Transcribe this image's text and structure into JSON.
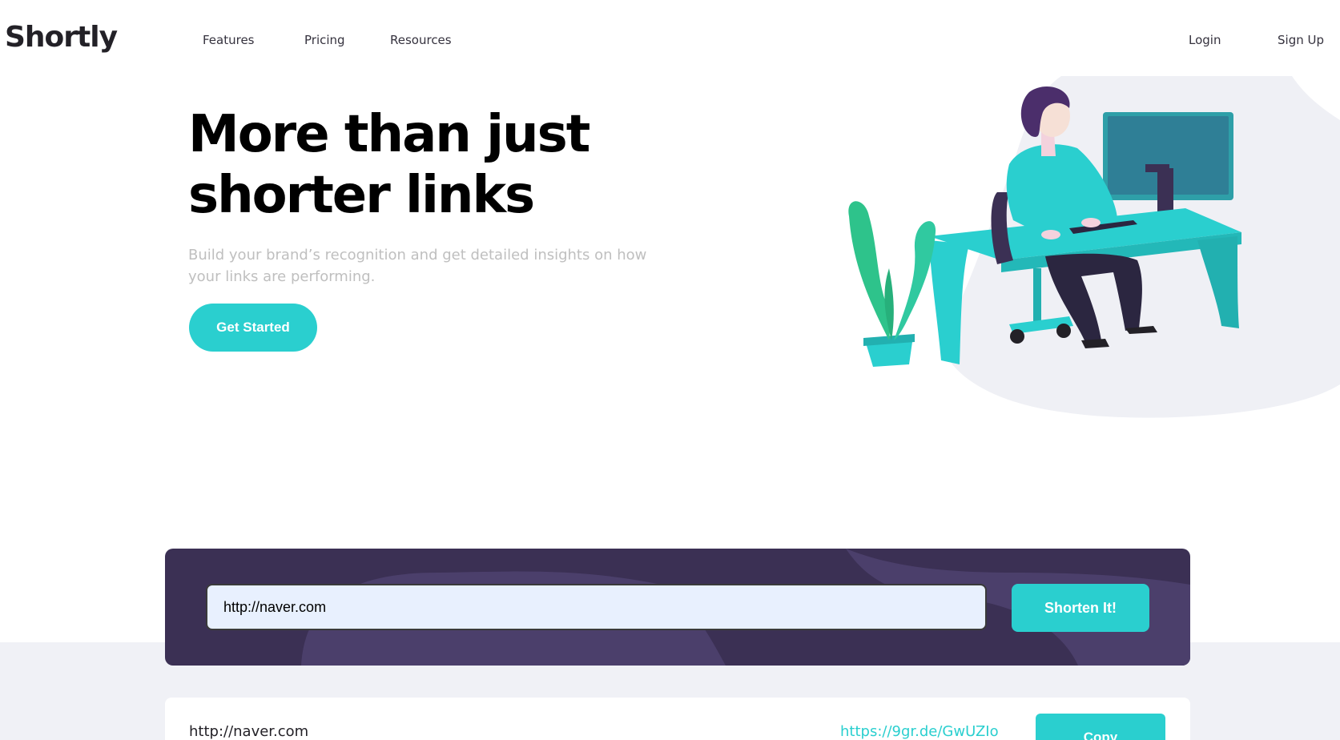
{
  "header": {
    "logo": "Shortly",
    "nav": {
      "features": "Features",
      "pricing": "Pricing",
      "resources": "Resources",
      "login": "Login",
      "signup": "Sign Up"
    }
  },
  "hero": {
    "title": "More than just shorter links",
    "subtitle": "Build your brand’s recognition and get detailed insights on how your links are performing.",
    "cta": "Get Started"
  },
  "shortener": {
    "input_value": "http://naver.com",
    "button": "Shorten It!"
  },
  "result": {
    "original": "http://naver.com",
    "short": "https://9gr.de/GwUZIo",
    "copy": "Copy"
  },
  "colors": {
    "accent": "#2acfcf",
    "panel": "#3b3054",
    "band": "#f0f1f6"
  },
  "icons": {
    "illustration": "person-working-at-desk-illustration"
  }
}
